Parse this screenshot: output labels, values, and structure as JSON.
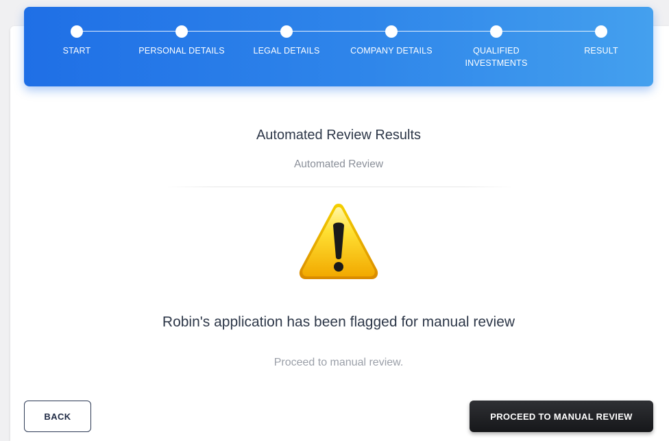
{
  "stepper": {
    "steps": [
      {
        "label": "START"
      },
      {
        "label": "PERSONAL DETAILS"
      },
      {
        "label": "LEGAL DETAILS"
      },
      {
        "label": "COMPANY DETAILS"
      },
      {
        "label": "QUALIFIED INVESTMENTS"
      },
      {
        "label": "RESULT"
      }
    ],
    "colors": {
      "gradient_start": "#1f6fe6",
      "gradient_end": "#44a0ee",
      "dot": "#ffffff"
    }
  },
  "review": {
    "title": "Automated Review Results",
    "subtitle": "Automated Review",
    "status_icon": "warning-icon",
    "message": "Robin's application has been flagged for manual review",
    "hint": "Proceed to manual review."
  },
  "actions": {
    "back_label": "BACK",
    "proceed_label": "PROCEED TO MANUAL REVIEW"
  }
}
